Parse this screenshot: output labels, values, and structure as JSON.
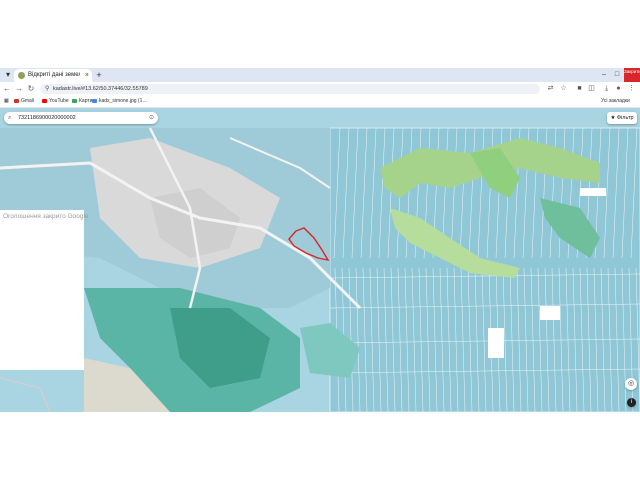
{
  "browser": {
    "tab_title": "Відкриті дані земельного када…",
    "tab_close": "×",
    "new_tab": "+",
    "url": "kadastr.live/#13.62/50.37446/32.55789",
    "window_controls": [
      "–",
      "□"
    ],
    "corner_badge": "Закрити"
  },
  "nav": {
    "back": "←",
    "forward": "→",
    "reload": "↻",
    "lock": "⚲"
  },
  "bookmarks": [
    {
      "label": "Gmail",
      "icon": "gmail-icon",
      "color": "#d93025"
    },
    {
      "label": "YouTube",
      "icon": "youtube-icon",
      "color": "#ff0000"
    },
    {
      "label": "Карти",
      "icon": "maps-icon",
      "color": "#34a853"
    },
    {
      "label": "kadx_simone.jpg (1…",
      "icon": "drive-icon",
      "color": "#4285f4"
    }
  ],
  "bookmarks_all": "Усі закладки",
  "map": {
    "search_value": "7321186900020000002",
    "filter_label": "Фільтр",
    "google_notice": "Оголошення закрито Google",
    "locate": "◎",
    "info": "i"
  },
  "colors": {
    "parcel_blue": "#8fc7d6",
    "parcel_teal": "#5bb5a6",
    "parcel_green": "#a6d38b",
    "selected": "#d62828",
    "water": "#a9d4e2",
    "village": "#d9d9d9"
  }
}
